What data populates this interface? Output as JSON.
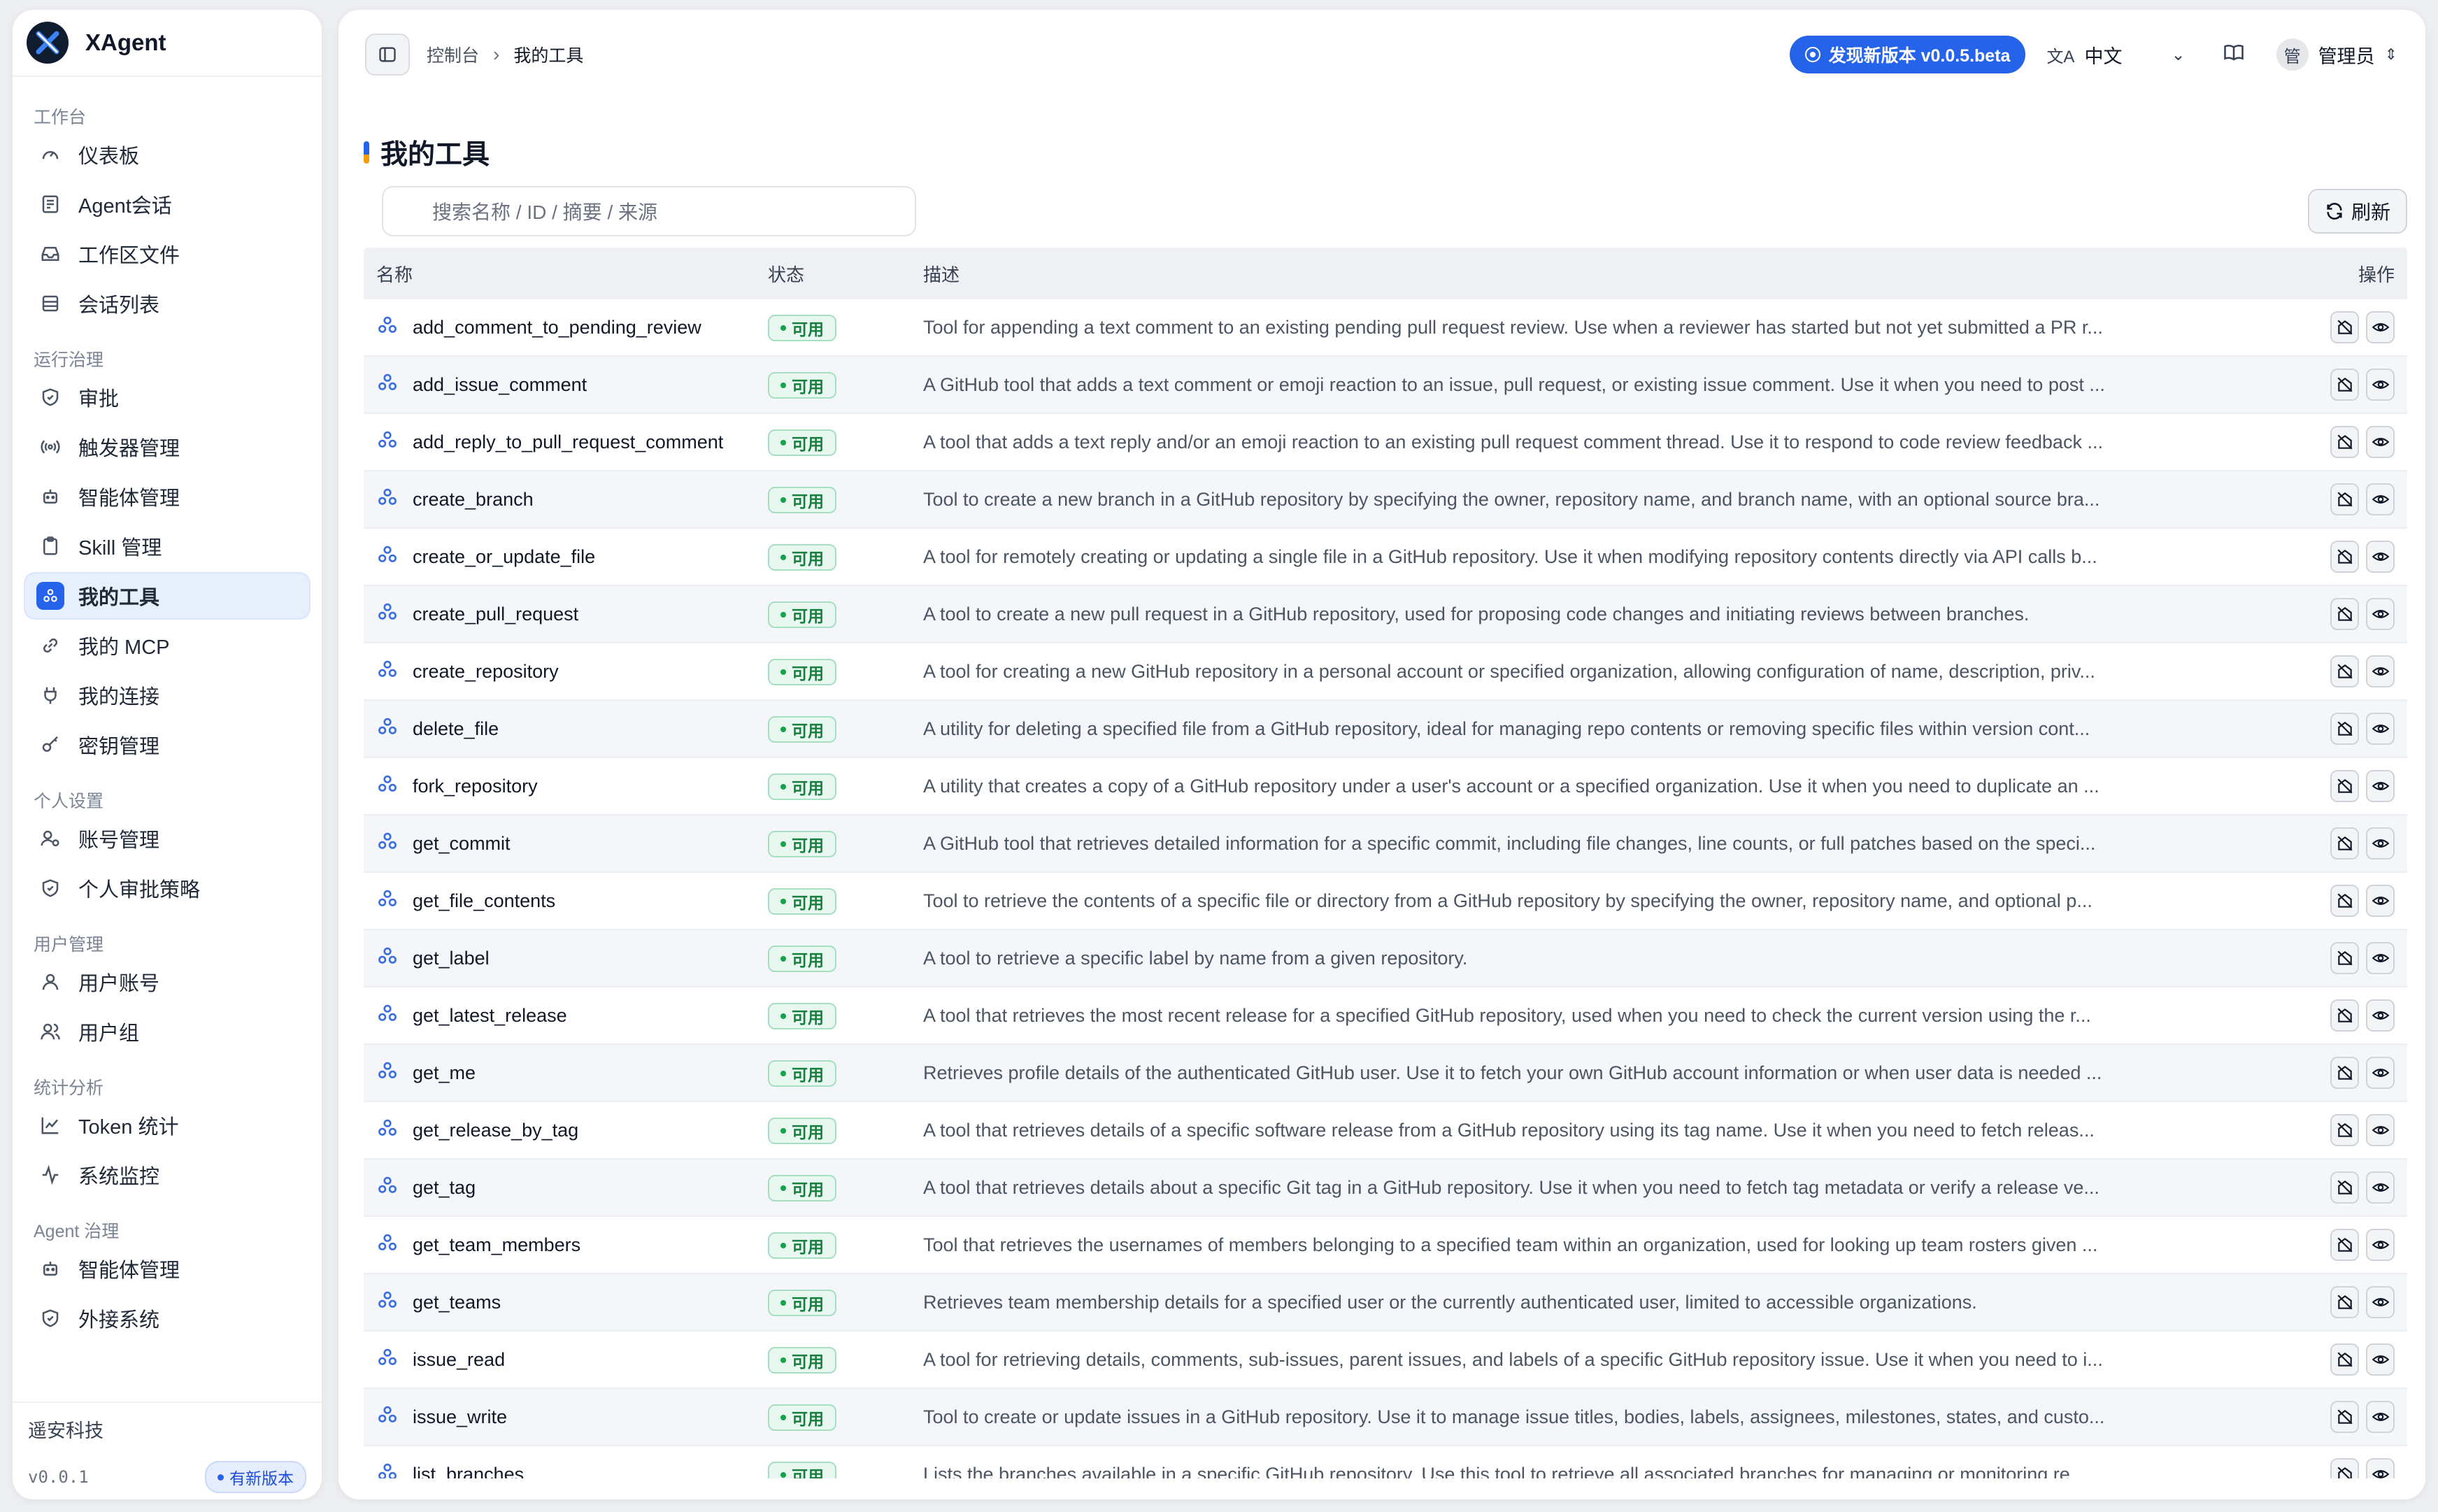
{
  "brand": {
    "name": "XAgent"
  },
  "sidebar": {
    "groups": [
      {
        "title": "工作台",
        "items": [
          {
            "label": "仪表板",
            "icon": "gauge-icon"
          },
          {
            "label": "Agent会话",
            "icon": "document-icon"
          },
          {
            "label": "工作区文件",
            "icon": "inbox-icon"
          },
          {
            "label": "会话列表",
            "icon": "list-icon"
          }
        ]
      },
      {
        "title": "运行治理",
        "items": [
          {
            "label": "审批",
            "icon": "shield-icon"
          },
          {
            "label": "触发器管理",
            "icon": "radio-icon"
          },
          {
            "label": "智能体管理",
            "icon": "bot-icon"
          },
          {
            "label": "Skill 管理",
            "icon": "clipboard-icon"
          },
          {
            "label": "我的工具",
            "icon": "tools-icon",
            "active": true
          },
          {
            "label": "我的 MCP",
            "icon": "link-icon"
          },
          {
            "label": "我的连接",
            "icon": "plug-icon"
          },
          {
            "label": "密钥管理",
            "icon": "key-icon"
          }
        ]
      },
      {
        "title": "个人设置",
        "items": [
          {
            "label": "账号管理",
            "icon": "user-gear-icon"
          },
          {
            "label": "个人审批策略",
            "icon": "shield-icon"
          }
        ]
      },
      {
        "title": "用户管理",
        "items": [
          {
            "label": "用户账号",
            "icon": "user-icon"
          },
          {
            "label": "用户组",
            "icon": "users-icon"
          }
        ]
      },
      {
        "title": "统计分析",
        "items": [
          {
            "label": "Token 统计",
            "icon": "line-chart-icon"
          },
          {
            "label": "系统监控",
            "icon": "activity-icon"
          }
        ]
      },
      {
        "title": "Agent 治理",
        "items": [
          {
            "label": "智能体管理",
            "icon": "bot-icon"
          },
          {
            "label": "外接系统",
            "icon": "shield-icon"
          }
        ]
      }
    ],
    "footer": {
      "company": "遥安科技",
      "version": "v0.0.1",
      "new_version_badge": "有新版本"
    }
  },
  "topbar": {
    "breadcrumb": [
      "控制台",
      "我的工具"
    ],
    "version_pill": "发现新版本 v0.0.5.beta",
    "language": "中文",
    "user": {
      "avatar": "管",
      "name": "管理员"
    }
  },
  "page": {
    "title": "我的工具",
    "search_placeholder": "搜索名称 / ID / 摘要 / 来源",
    "refresh_label": "刷新"
  },
  "table": {
    "headers": {
      "name": "名称",
      "status": "状态",
      "desc": "描述",
      "ops": "操作"
    },
    "rows": [
      {
        "name": "add_comment_to_pending_review",
        "status": "可用",
        "desc": "Tool for appending a text comment to an existing pending pull request review. Use when a reviewer has started but not yet submitted a PR r..."
      },
      {
        "name": "add_issue_comment",
        "status": "可用",
        "desc": "A GitHub tool that adds a text comment or emoji reaction to an issue, pull request, or existing issue comment. Use it when you need to post ..."
      },
      {
        "name": "add_reply_to_pull_request_comment",
        "status": "可用",
        "desc": "A tool that adds a text reply and/or an emoji reaction to an existing pull request comment thread. Use it to respond to code review feedback ..."
      },
      {
        "name": "create_branch",
        "status": "可用",
        "desc": "Tool to create a new branch in a GitHub repository by specifying the owner, repository name, and branch name, with an optional source bra..."
      },
      {
        "name": "create_or_update_file",
        "status": "可用",
        "desc": "A tool for remotely creating or updating a single file in a GitHub repository. Use it when modifying repository contents directly via API calls b..."
      },
      {
        "name": "create_pull_request",
        "status": "可用",
        "desc": "A tool to create a new pull request in a GitHub repository, used for proposing code changes and initiating reviews between branches."
      },
      {
        "name": "create_repository",
        "status": "可用",
        "desc": "A tool for creating a new GitHub repository in a personal account or specified organization, allowing configuration of name, description, priv..."
      },
      {
        "name": "delete_file",
        "status": "可用",
        "desc": "A utility for deleting a specified file from a GitHub repository, ideal for managing repo contents or removing specific files within version cont..."
      },
      {
        "name": "fork_repository",
        "status": "可用",
        "desc": "A utility that creates a copy of a GitHub repository under a user's account or a specified organization. Use it when you need to duplicate an ..."
      },
      {
        "name": "get_commit",
        "status": "可用",
        "desc": "A GitHub tool that retrieves detailed information for a specific commit, including file changes, line counts, or full patches based on the speci..."
      },
      {
        "name": "get_file_contents",
        "status": "可用",
        "desc": "Tool to retrieve the contents of a specific file or directory from a GitHub repository by specifying the owner, repository name, and optional p..."
      },
      {
        "name": "get_label",
        "status": "可用",
        "desc": "A tool to retrieve a specific label by name from a given repository."
      },
      {
        "name": "get_latest_release",
        "status": "可用",
        "desc": "A tool that retrieves the most recent release for a specified GitHub repository, used when you need to check the current version using the r..."
      },
      {
        "name": "get_me",
        "status": "可用",
        "desc": "Retrieves profile details of the authenticated GitHub user. Use it to fetch your own GitHub account information or when user data is needed ..."
      },
      {
        "name": "get_release_by_tag",
        "status": "可用",
        "desc": "A tool that retrieves details of a specific software release from a GitHub repository using its tag name. Use it when you need to fetch releas..."
      },
      {
        "name": "get_tag",
        "status": "可用",
        "desc": "A tool that retrieves details about a specific Git tag in a GitHub repository. Use it when you need to fetch tag metadata or verify a release ve..."
      },
      {
        "name": "get_team_members",
        "status": "可用",
        "desc": "Tool that retrieves the usernames of members belonging to a specified team within an organization, used for looking up team rosters given ..."
      },
      {
        "name": "get_teams",
        "status": "可用",
        "desc": "Retrieves team membership details for a specified user or the currently authenticated user, limited to accessible organizations."
      },
      {
        "name": "issue_read",
        "status": "可用",
        "desc": "A tool for retrieving details, comments, sub-issues, parent issues, and labels of a specific GitHub repository issue. Use it when you need to i..."
      },
      {
        "name": "issue_write",
        "status": "可用",
        "desc": "Tool to create or update issues in a GitHub repository. Use it to manage issue titles, bodies, labels, assignees, milestones, states, and custo..."
      },
      {
        "name": "list_branches",
        "status": "可用",
        "desc": "Lists the branches available in a specific GitHub repository. Use this tool to retrieve all associated branches for managing or monitoring re..."
      }
    ]
  },
  "colors": {
    "accent": "#2563eb",
    "success": "#15803d",
    "success_bg": "#e8f7ef"
  }
}
